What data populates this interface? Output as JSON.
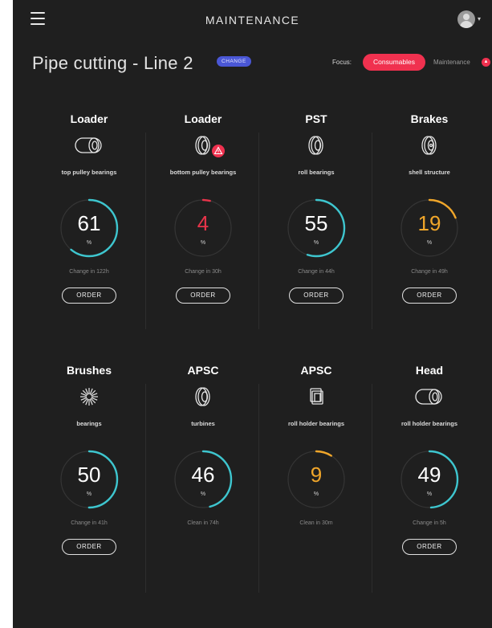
{
  "header": {
    "title": "MAINTENANCE"
  },
  "page": {
    "title": "Pipe cutting - Line 2",
    "change_label": "CHANGE",
    "focus_label": "Focus:",
    "focus_selected": "Consumables",
    "focus_other": "Maintenance"
  },
  "colors": {
    "teal": "#3ec6cf",
    "red": "#e8344a",
    "orange": "#f0a62a",
    "track": "#353535"
  },
  "cards": [
    {
      "name": "Loader",
      "icon": "bearing-wide-icon",
      "part": "top pulley bearings",
      "value": "61",
      "percent": 61,
      "status": "teal",
      "unit": "%",
      "note": "Change in 122h",
      "order": "ORDER",
      "warning": false
    },
    {
      "name": "Loader",
      "icon": "bearing-icon",
      "part": "bottom pulley bearings",
      "value": "4",
      "percent": 4,
      "status": "red",
      "unit": "%",
      "note": "Change in 30h",
      "order": "ORDER",
      "warning": true
    },
    {
      "name": "PST",
      "icon": "bearing-icon",
      "part": "roll bearings",
      "value": "55",
      "percent": 55,
      "status": "teal",
      "unit": "%",
      "note": "Change in 44h",
      "order": "ORDER",
      "warning": false
    },
    {
      "name": "Brakes",
      "icon": "shell-icon",
      "part": "shell structure",
      "value": "19",
      "percent": 19,
      "status": "orange",
      "unit": "%",
      "note": "Change in 49h",
      "order": "ORDER",
      "warning": false
    },
    {
      "name": "Brushes",
      "icon": "brush-icon",
      "part": "bearings",
      "value": "50",
      "percent": 50,
      "status": "teal",
      "unit": "%",
      "note": "Change in 41h",
      "order": "ORDER",
      "warning": false
    },
    {
      "name": "APSC",
      "icon": "bearing-icon",
      "part": "turbines",
      "value": "46",
      "percent": 46,
      "status": "teal",
      "unit": "%",
      "note": "Clean in 74h",
      "order": "",
      "warning": false
    },
    {
      "name": "APSC",
      "icon": "holder-icon",
      "part": "roll holder bearings",
      "value": "9",
      "percent": 9,
      "status": "orange",
      "unit": "%",
      "note": "Clean in 30m",
      "order": "",
      "warning": false
    },
    {
      "name": "Head",
      "icon": "cylinder-icon",
      "part": "roll holder bearings",
      "value": "49",
      "percent": 49,
      "status": "teal",
      "unit": "%",
      "note": "Change in 5h",
      "order": "ORDER",
      "warning": false
    }
  ]
}
